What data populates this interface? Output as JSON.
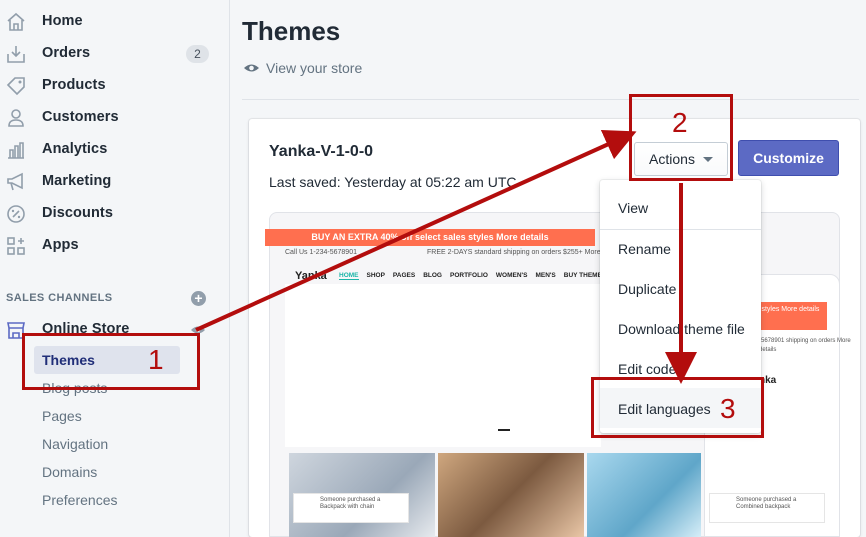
{
  "sidebar": {
    "items": [
      {
        "label": "Home",
        "icon": "home-icon"
      },
      {
        "label": "Orders",
        "icon": "orders-icon",
        "badge": "2"
      },
      {
        "label": "Products",
        "icon": "tag-icon"
      },
      {
        "label": "Customers",
        "icon": "person-icon"
      },
      {
        "label": "Analytics",
        "icon": "bar-chart-icon"
      },
      {
        "label": "Marketing",
        "icon": "megaphone-icon"
      },
      {
        "label": "Discounts",
        "icon": "discount-icon"
      },
      {
        "label": "Apps",
        "icon": "apps-icon"
      }
    ],
    "sales_channels_title": "SALES CHANNELS",
    "online_store": "Online Store",
    "sub_items": [
      "Themes",
      "Blog posts",
      "Pages",
      "Navigation",
      "Domains",
      "Preferences"
    ]
  },
  "main": {
    "title": "Themes",
    "view_store": "View your store"
  },
  "theme_card": {
    "name": "Yanka-V-1-0-0",
    "last_saved": "Last saved: Yesterday at 05:22 am UTC",
    "actions_label": "Actions",
    "customize_label": "Customize"
  },
  "preview": {
    "banner": "BUY AN EXTRA 40% off select sales styles More details",
    "call_us": "Call Us 1-234-5678901",
    "shipping": "FREE 2-DAYS standard shipping on orders $255+ More details",
    "logo": "Yanka",
    "menu": [
      "HOME",
      "SHOP",
      "PAGES",
      "BLOG",
      "PORTFOLIO",
      "WOMEN'S",
      "MEN'S",
      "BUY THEME!"
    ],
    "popup1": "Someone purchased a Backpack with chain",
    "popup2": "Someone purchased a Combined backpack",
    "mobile_banner": "EXTRA 40% off styles More details",
    "mobile_text": "-5678901 shipping on orders More details",
    "mobile_logo": "nka"
  },
  "dropdown": {
    "items": [
      "View",
      "Rename",
      "Duplicate",
      "Download theme file",
      "Edit code",
      "Edit languages"
    ]
  },
  "annotations": {
    "step1": "1",
    "step2": "2",
    "step3": "3",
    "color": "#b30d0d"
  },
  "colors": {
    "accent": "#5c6ac4",
    "banner": "#ff6f4f"
  }
}
